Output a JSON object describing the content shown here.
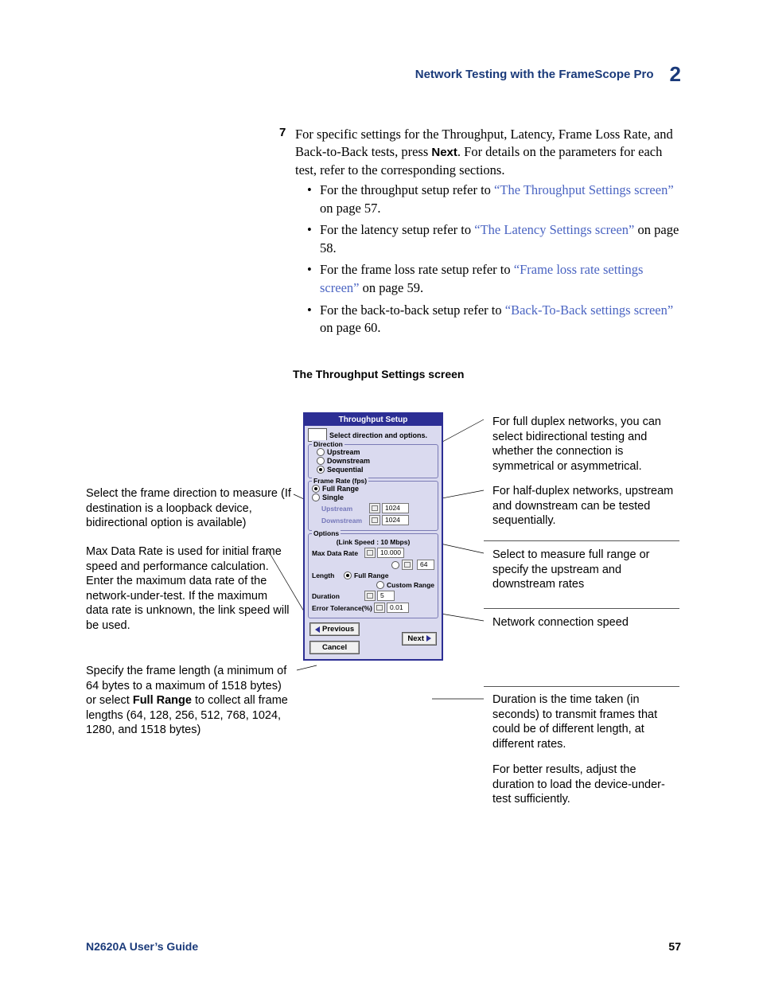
{
  "header": {
    "title": "Network Testing with the FrameScope Pro",
    "chapter": "2"
  },
  "step": {
    "num": "7",
    "text_pre": "For specific settings for the Throughput, Latency, Frame Loss Rate, and Back-to-Back tests, press ",
    "next_word": "Next",
    "text_post": ". For details on the parameters for each test, refer to the corresponding sections."
  },
  "bullets": [
    {
      "pre": "For the throughput setup refer to ",
      "link": "“The Throughput Settings screen”",
      "post": " on page 57."
    },
    {
      "pre": "For the latency setup refer to ",
      "link": "“The Latency Settings screen”",
      "post": " on page 58."
    },
    {
      "pre": "For the frame loss rate setup refer to ",
      "link": "“Frame loss rate settings screen”",
      "post": " on page 59."
    },
    {
      "pre": "For the back-to-back setup refer to ",
      "link": "“Back-To-Back settings screen”",
      "post": " on page 60."
    }
  ],
  "sub_heading": "The Throughput Settings screen",
  "anno_left": [
    "Select the frame direction to measure (If destination is a loopback device, bidirectional option is available)",
    "Max Data Rate is used for initial frame speed and performance calculation. Enter the maximum data rate of the network-under-test. If the maximum data rate is unknown, the link speed will be used.",
    "Specify the frame length (a minimum of 64 bytes to a maximum of 1518 bytes) or select Full Range to collect all frame lengths (64, 128, 256, 512, 768, 1024, 1280, and 1518 bytes)"
  ],
  "anno_right": [
    "For full duplex networks, you can select bidirectional testing and whether the connection is symmetrical or asymmetrical.",
    "For half-duplex networks, upstream and downstream can be tested sequentially.",
    "Select to measure full range or specify the upstream and downstream rates",
    "Network connection speed",
    "Duration is the time taken (in seconds) to transmit frames that could be of different length, at different rates.",
    "For better results, adjust the duration to load the device-under-test sufficiently."
  ],
  "screen": {
    "title": "Throughput Setup",
    "instruction": "Select direction and options.",
    "groups": {
      "direction": {
        "label": "Direction",
        "options": [
          "Upstream",
          "Downstream",
          "Sequential"
        ],
        "selected": "Sequential"
      },
      "frame_rate": {
        "label": "Frame Rate (fps)",
        "options": [
          "Full Range",
          "Single"
        ],
        "selected": "Full Range",
        "fields": [
          {
            "label": "Upstream",
            "value": "1024"
          },
          {
            "label": "Downstream",
            "value": "1024"
          }
        ]
      },
      "options": {
        "label": "Options",
        "link_speed": "(Link Speed : 10 Mbps)",
        "max_data_rate": {
          "label": "Max Data Rate",
          "value": "10.000"
        },
        "small_val": "64",
        "length": {
          "label": "Length",
          "options": [
            "Full Range",
            "Custom Range"
          ],
          "selected": "Full Range"
        },
        "duration": {
          "label": "Duration",
          "value": "5"
        },
        "error_tol": {
          "label": "Error Tolerance(%)",
          "value": "0.01"
        }
      }
    },
    "buttons": {
      "previous": "Previous",
      "next": "Next",
      "cancel": "Cancel"
    }
  },
  "footer": {
    "left": "N2620A User’s Guide",
    "page": "57"
  }
}
